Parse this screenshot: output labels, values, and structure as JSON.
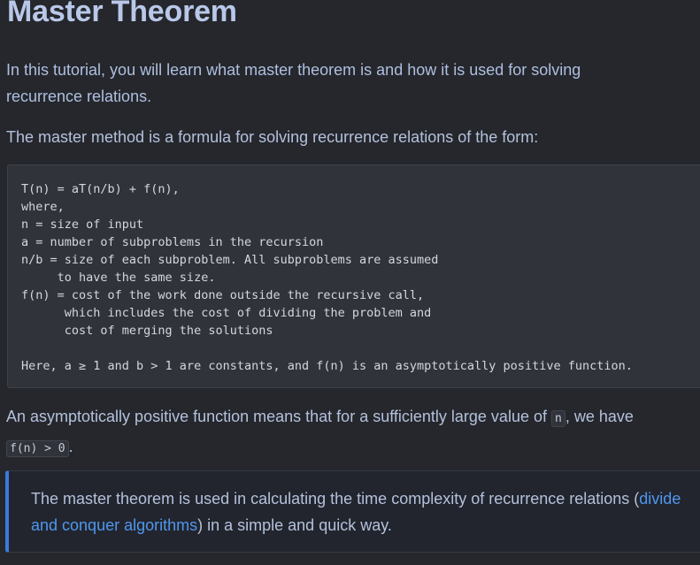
{
  "title": "Master Theorem",
  "intro": "In this tutorial, you will learn what master theorem is and how it is used for solving recurrence relations.",
  "para1": "The master method is a formula for solving recurrence relations of the form:",
  "code_block": "T(n) = aT(n/b) + f(n),\nwhere,\nn = size of input\na = number of subproblems in the recursion\nn/b = size of each subproblem. All subproblems are assumed\n     to have the same size.\nf(n) = cost of the work done outside the recursive call,\n      which includes the cost of dividing the problem and\n      cost of merging the solutions\n\nHere, a ≥ 1 and b > 1 are constants, and f(n) is an asymptotically positive function.",
  "para2": {
    "text_before": "An asymptotically positive function means that for a sufficiently large value of ",
    "code_n": "n",
    "text_middle": ", we have",
    "code_fn": "f(n) > 0",
    "text_after": "."
  },
  "callout": {
    "text_before": "The master theorem is used in calculating the time complexity of recurrence relations (",
    "link_text": "divide and conquer algorithms",
    "text_after": ") in a simple and quick way."
  },
  "colors": {
    "background": "#25272c",
    "title": "#b9c8e8",
    "link": "#4f97f0",
    "callout_border": "#3a7be0"
  }
}
